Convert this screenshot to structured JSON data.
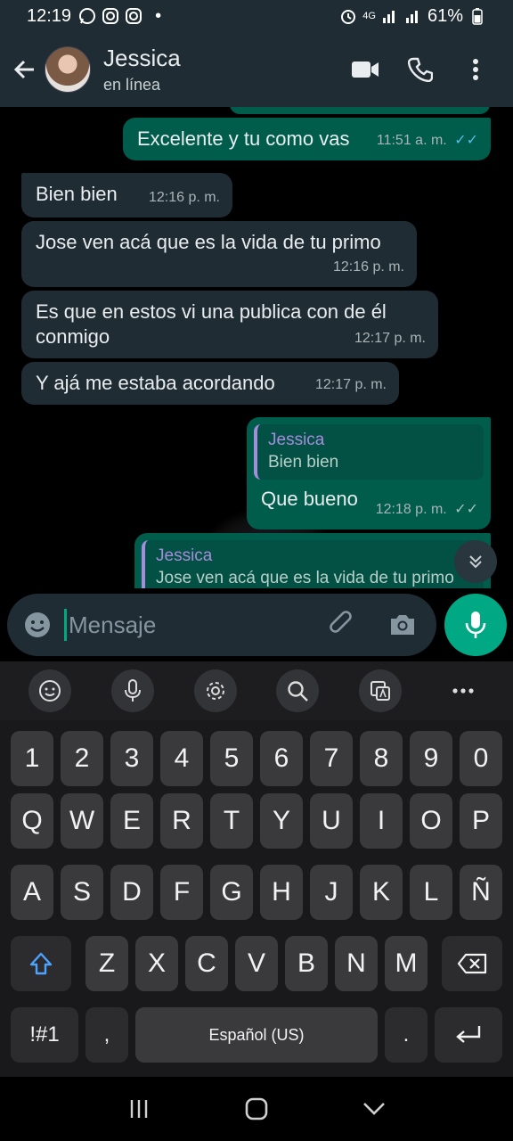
{
  "status_bar": {
    "time": "12:19",
    "dot": "•",
    "network": "4G",
    "battery": "61%",
    "icons": [
      "whatsapp-icon",
      "instagram-icon",
      "instagram-icon",
      "alarm-icon",
      "signal-icon",
      "battery-icon"
    ]
  },
  "header": {
    "contact_name": "Jessica",
    "contact_status": "en línea"
  },
  "messages": [
    {
      "direction": "out",
      "text": "Excelente y tu como vas",
      "time": "11:51 a. m.",
      "ticks": "read"
    },
    {
      "direction": "in",
      "text": "Bien bien",
      "time": "12:16 p. m."
    },
    {
      "direction": "in",
      "text": "Jose ven acá que es la vida de tu primo",
      "time": "12:16 p. m."
    },
    {
      "direction": "in",
      "text": "Es que en estos vi una publica con de él conmigo",
      "time": "12:17 p. m."
    },
    {
      "direction": "in",
      "text": "Y ajá me estaba acordando",
      "time": "12:17 p. m."
    },
    {
      "direction": "out",
      "quote_name": "Jessica",
      "quote_text": "Bien bien",
      "text": "Que bueno",
      "time": "12:18 p. m.",
      "ticks": "delivered"
    },
    {
      "direction": "out",
      "quote_name": "Jessica",
      "quote_text": "Jose ven acá que es la vida de tu primo"
    }
  ],
  "composer": {
    "placeholder": "Mensaje"
  },
  "keyboard": {
    "number_row": [
      "1",
      "2",
      "3",
      "4",
      "5",
      "6",
      "7",
      "8",
      "9",
      "0"
    ],
    "row1": [
      "Q",
      "W",
      "E",
      "R",
      "T",
      "Y",
      "U",
      "I",
      "O",
      "P"
    ],
    "row2": [
      "A",
      "S",
      "D",
      "F",
      "G",
      "H",
      "J",
      "K",
      "L",
      "Ñ"
    ],
    "row3": [
      "Z",
      "X",
      "C",
      "V",
      "B",
      "N",
      "M"
    ],
    "symbols_label": "!#1",
    "comma_label": ",",
    "space_label": "Español (US)",
    "period_label": "."
  },
  "colors": {
    "header_bg": "#1f2c33",
    "incoming_bubble": "#202c33",
    "outgoing_bubble": "#005c4b",
    "accent": "#00a884",
    "read_ticks": "#53bdeb",
    "quote_name": "#a78bdc"
  }
}
